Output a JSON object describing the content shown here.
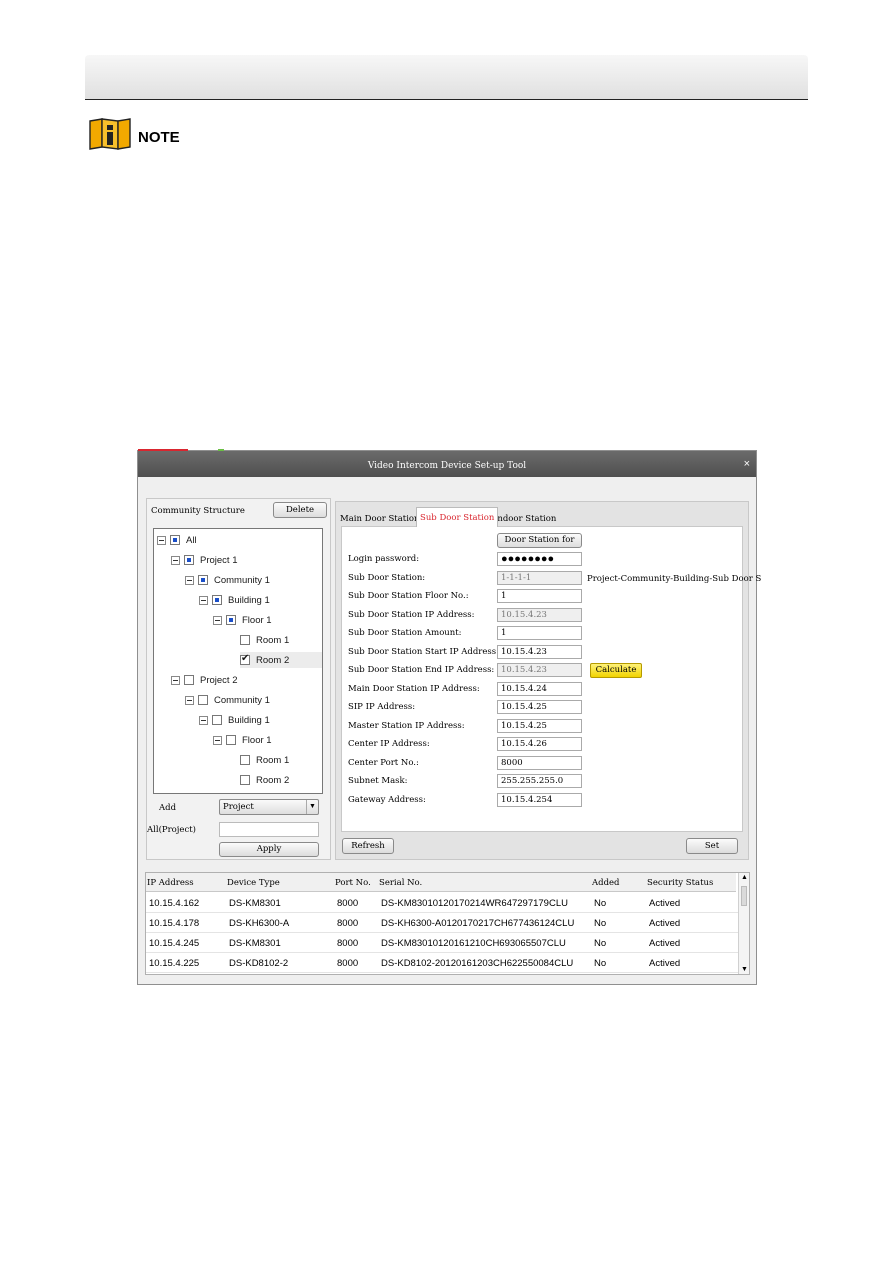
{
  "doc": {
    "note": "NOTE"
  },
  "window": {
    "title": "Video Intercom Device Set-up Tool",
    "close": "×"
  },
  "left": {
    "community_structure": "Community Structure",
    "delete": "Delete",
    "tree": [
      {
        "label": "All",
        "state": "partial",
        "expander": true
      },
      {
        "label": "Project 1",
        "state": "partial",
        "expander": true
      },
      {
        "label": "Community 1",
        "state": "partial",
        "expander": true
      },
      {
        "label": "Building 1",
        "state": "partial",
        "expander": true
      },
      {
        "label": "Floor 1",
        "state": "partial",
        "expander": true
      },
      {
        "label": "Room 1",
        "state": "unchecked",
        "expander": false
      },
      {
        "label": "Room 2",
        "state": "checked",
        "expander": false,
        "selected": true
      },
      {
        "label": "Project 2",
        "state": "unchecked",
        "expander": true
      },
      {
        "label": "Community 1",
        "state": "unchecked",
        "expander": true
      },
      {
        "label": "Building 1",
        "state": "unchecked",
        "expander": true
      },
      {
        "label": "Floor 1",
        "state": "unchecked",
        "expander": true
      },
      {
        "label": "Room 1",
        "state": "unchecked",
        "expander": false
      },
      {
        "label": "Room 2",
        "state": "unchecked",
        "expander": false
      }
    ],
    "add_label": "Add",
    "add_value": "Project",
    "all_label": "All(Project)",
    "all_value": "",
    "apply": "Apply"
  },
  "tabs": {
    "main": "Main Door Station",
    "sub": "Sub Door Station",
    "indoor": "Indoor Station"
  },
  "form": {
    "door_station_for": "Door Station for",
    "hint": "Project-Community-Building-Sub Door S",
    "calculate": "Calculate",
    "fields": [
      {
        "label": "Login password:",
        "value": "●●●●●●●●"
      },
      {
        "label": "Sub Door Station:",
        "value": "1-1-1-1"
      },
      {
        "label": "Sub Door Station Floor No.:",
        "value": "1"
      },
      {
        "label": "Sub Door Station IP Address:",
        "value": "10.15.4.23"
      },
      {
        "label": "Sub Door Station Amount:",
        "value": "1"
      },
      {
        "label": "Sub Door Station Start IP Address:",
        "value": "10.15.4.23"
      },
      {
        "label": "Sub Door Station End IP Address:",
        "value": "10.15.4.23"
      },
      {
        "label": "Main Door Station IP Address:",
        "value": "10.15.4.24"
      },
      {
        "label": "SIP IP Address:",
        "value": "10.15.4.25"
      },
      {
        "label": "Master Station IP Address:",
        "value": "10.15.4.25"
      },
      {
        "label": "Center IP Address:",
        "value": "10.15.4.26"
      },
      {
        "label": "Center Port No.:",
        "value": "8000"
      },
      {
        "label": "Subnet Mask:",
        "value": "255.255.255.0"
      },
      {
        "label": "Gateway Address:",
        "value": "10.15.4.254"
      }
    ]
  },
  "buttons": {
    "refresh": "Refresh",
    "set": "Set"
  },
  "table": {
    "headers": [
      "IP Address",
      "Device Type",
      "Port No.",
      "Serial No.",
      "Added",
      "Security Status"
    ],
    "rows": [
      [
        "10.15.4.162",
        "DS-KM8301",
        "8000",
        "DS-KM83010120170214WR647297179CLU",
        "No",
        "Actived"
      ],
      [
        "10.15.4.178",
        "DS-KH6300-A",
        "8000",
        "DS-KH6300-A0120170217CH677436124CLU",
        "No",
        "Actived"
      ],
      [
        "10.15.4.245",
        "DS-KM8301",
        "8000",
        "DS-KM83010120161210CH693065507CLU",
        "No",
        "Actived"
      ],
      [
        "10.15.4.225",
        "DS-KD8102-2",
        "8000",
        "DS-KD8102-20120161203CH622550084CLU",
        "No",
        "Actived"
      ]
    ]
  }
}
